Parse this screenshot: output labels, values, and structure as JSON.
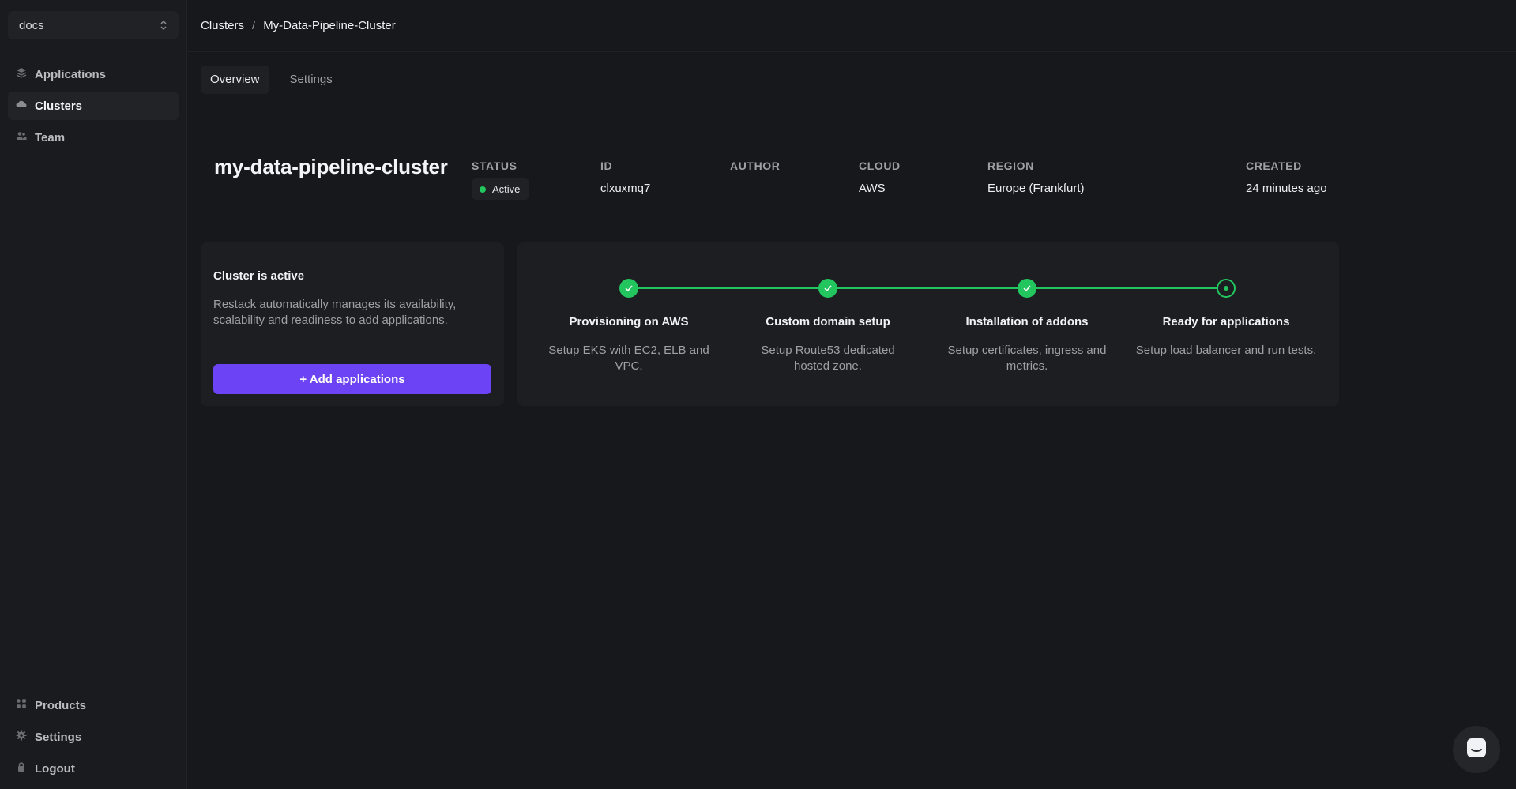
{
  "sidebar": {
    "workspace": "docs",
    "items": [
      {
        "label": "Applications",
        "icon": "layers-icon"
      },
      {
        "label": "Clusters",
        "icon": "cloud-icon"
      },
      {
        "label": "Team",
        "icon": "users-icon"
      }
    ],
    "bottom_items": [
      {
        "label": "Products",
        "icon": "grid-icon"
      },
      {
        "label": "Settings",
        "icon": "gear-icon"
      },
      {
        "label": "Logout",
        "icon": "lock-icon"
      }
    ]
  },
  "breadcrumb": [
    "Clusters",
    "My-Data-Pipeline-Cluster"
  ],
  "tabs": [
    "Overview",
    "Settings"
  ],
  "cluster": {
    "name": "my-data-pipeline-cluster",
    "status_label": "STATUS",
    "status": "Active",
    "id_label": "ID",
    "id": "clxuxmq7",
    "author_label": "AUTHOR",
    "author": "",
    "cloud_label": "CLOUD",
    "cloud": "AWS",
    "region_label": "REGION",
    "region": "Europe (Frankfurt)",
    "created_label": "CREATED",
    "created": "24 minutes ago"
  },
  "status_card": {
    "title": "Cluster is active",
    "description": "Restack automatically manages its availability, scalability and readiness to add applications.",
    "button": "+ Add applications"
  },
  "steps": [
    {
      "title": "Provisioning on AWS",
      "description": "Setup EKS with EC2, ELB and VPC.",
      "state": "done"
    },
    {
      "title": "Custom domain setup",
      "description": "Setup Route53 dedicated hosted zone.",
      "state": "done"
    },
    {
      "title": "Installation of addons",
      "description": "Setup certificates, ingress and metrics.",
      "state": "done"
    },
    {
      "title": "Ready for applications",
      "description": "Setup load balancer and run tests.",
      "state": "current"
    }
  ],
  "colors": {
    "accent": "#6d44f5",
    "success": "#22c55e",
    "background": "#17181b"
  }
}
